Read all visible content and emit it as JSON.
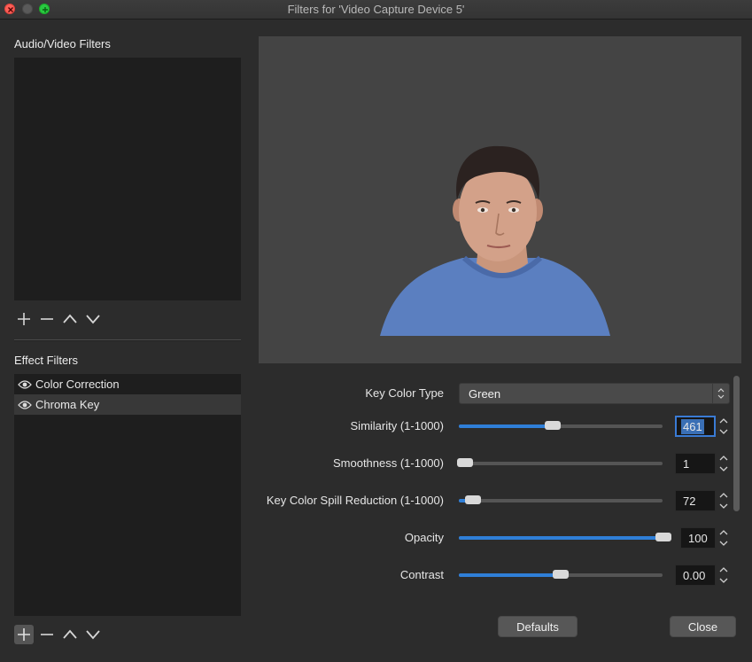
{
  "window": {
    "title": "Filters for 'Video Capture Device 5'"
  },
  "audio_video": {
    "label": "Audio/Video Filters",
    "items": []
  },
  "effect": {
    "label": "Effect Filters",
    "items": [
      {
        "label": "Color Correction",
        "selected": false
      },
      {
        "label": "Chroma Key",
        "selected": true
      }
    ]
  },
  "properties": {
    "key_color_type": {
      "label": "Key Color Type",
      "value": "Green"
    },
    "similarity": {
      "label": "Similarity (1-1000)",
      "value": "461",
      "level": 0.46
    },
    "smoothness": {
      "label": "Smoothness (1-1000)",
      "value": "1",
      "level": 0.0
    },
    "spill": {
      "label": "Key Color Spill Reduction (1-1000)",
      "value": "72",
      "level": 0.07
    },
    "opacity": {
      "label": "Opacity",
      "value": "100",
      "level": 1.0
    },
    "contrast": {
      "label": "Contrast",
      "value": "0.00",
      "level": 0.5
    }
  },
  "buttons": {
    "defaults": "Defaults",
    "close": "Close"
  },
  "colors": {
    "accent": "#2f7fd8",
    "close_light": "#fe5f57",
    "zoom_light": "#29c941"
  }
}
